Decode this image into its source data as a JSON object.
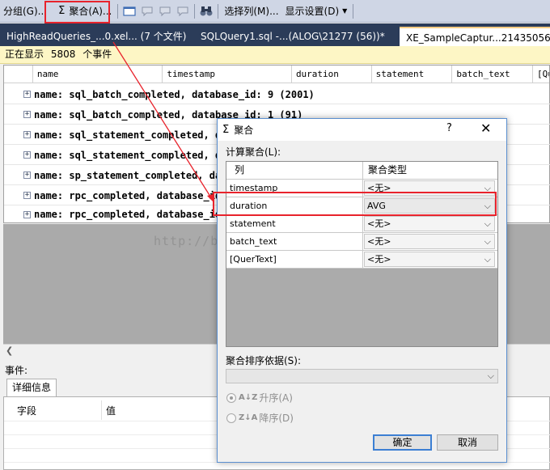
{
  "toolbar": {
    "group_label": "分组(G)...",
    "aggregate_label": "聚合(A)...",
    "choose_columns_label": "选择列(M)...",
    "display_settings_label": "显示设置(D)"
  },
  "tabs": [
    {
      "label": "HighReadQueries_...0.xel... (7 个文件)"
    },
    {
      "label": "SQLQuery1.sql -...(ALOG\\21277 (56))*"
    },
    {
      "label": "XE_SampleCaptur...2143505600"
    }
  ],
  "status": {
    "prefix": "正在显示",
    "count": "5808",
    "suffix": "个事件"
  },
  "grid": {
    "columns": [
      "name",
      "timestamp",
      "duration",
      "statement",
      "batch_text",
      "[Qu"
    ],
    "rows": [
      "name: sql_batch_completed, database_id: 9  (2001)",
      "name: sql_batch_completed, database_id: 1  (91)",
      "name: sql_statement_completed, da",
      "name: sql_statement_completed, da",
      "name: sp_statement_completed, da",
      "name: rpc_completed, database_id",
      "name: rpc_completed, database_id"
    ]
  },
  "watermark": "http://blog.csdn.net/DBA_Huangzj",
  "lower": {
    "events_label": "事件:",
    "details_tab": "详细信息",
    "field_header": "字段",
    "value_header": "值"
  },
  "dialog": {
    "title": "聚合",
    "help": "?",
    "close": "✕",
    "compute_label": "计算聚合(L):",
    "col_header": "列",
    "type_header": "聚合类型",
    "rows": [
      {
        "column": "timestamp",
        "type": "<无>"
      },
      {
        "column": "duration",
        "type": "AVG"
      },
      {
        "column": "statement",
        "type": "<无>"
      },
      {
        "column": "batch_text",
        "type": "<无>"
      },
      {
        "column": "[QuerText]",
        "type": "<无>"
      }
    ],
    "sort_label": "聚合排序依据(S):",
    "ascending": "升序(A)",
    "descending": "降序(D)",
    "ok": "确定",
    "cancel": "取消"
  },
  "colors": {
    "annotation": "#e8232c",
    "tab_bar": "#2b3c59",
    "status_bg": "#fdf6c5"
  }
}
